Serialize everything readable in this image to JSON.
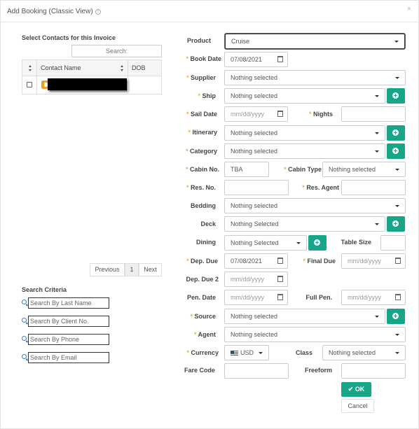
{
  "modal": {
    "title": "Add Booking (Classic View)",
    "close": "×",
    "help": "?"
  },
  "contacts": {
    "section_title": "Select Contacts for this Invoice",
    "search_placeholder": "Search:",
    "columns": [
      "Contact Name",
      "DOB"
    ],
    "pager": {
      "previous": "Previous",
      "page": "1",
      "next": "Next"
    }
  },
  "search_criteria": {
    "title": "Search Criteria",
    "fields": [
      "Search By Last Name",
      "Search By Client No.",
      "Search By Phone",
      "Search By Email"
    ]
  },
  "form": {
    "product": {
      "label": "Product",
      "value": "Cruise"
    },
    "book_date": {
      "label": "Book Date",
      "value": "07/08/2021"
    },
    "supplier": {
      "label": "Supplier",
      "value": "Nothing selected"
    },
    "ship": {
      "label": "Ship",
      "value": "Nothing selected"
    },
    "sail_date": {
      "label": "Sail Date",
      "placeholder": "mm/dd/yyyy"
    },
    "nights": {
      "label": "Nights",
      "value": ""
    },
    "itinerary": {
      "label": "Itinerary",
      "value": "Nothing selected"
    },
    "category": {
      "label": "Category",
      "value": "Nothing selected"
    },
    "cabin_no": {
      "label": "Cabin No.",
      "value": "TBA"
    },
    "cabin_type": {
      "label": "Cabin Type",
      "value": "Nothing selected"
    },
    "res_no": {
      "label": "Res. No.",
      "value": ""
    },
    "res_agent": {
      "label": "Res. Agent",
      "value": ""
    },
    "bedding": {
      "label": "Bedding",
      "value": "Nothing selected"
    },
    "deck": {
      "label": "Deck",
      "value": "Nothing Selected"
    },
    "dining": {
      "label": "Dining",
      "value": "Nothing Selected"
    },
    "table_size": {
      "label": "Table Size",
      "value": ""
    },
    "dep_due": {
      "label": "Dep. Due",
      "value": "07/08/2021"
    },
    "final_due": {
      "label": "Final Due",
      "placeholder": "mm/dd/yyyy"
    },
    "dep_due_2": {
      "label": "Dep. Due 2",
      "placeholder": "mm/dd/yyyy"
    },
    "pen_date": {
      "label": "Pen. Date",
      "placeholder": "mm/dd/yyyy"
    },
    "full_pen": {
      "label": "Full Pen.",
      "placeholder": "mm/dd/yyyy"
    },
    "source": {
      "label": "Source",
      "value": "Nothing selected"
    },
    "agent": {
      "label": "Agent",
      "value": "Nothing selected"
    },
    "currency": {
      "label": "Currency",
      "value": "USD"
    },
    "class": {
      "label": "Class",
      "value": "Nothing selected"
    },
    "fare_code": {
      "label": "Fare Code",
      "value": ""
    },
    "freeform": {
      "label": "Freeform",
      "value": ""
    }
  },
  "actions": {
    "ok": "OK",
    "cancel": "Cancel"
  },
  "colors": {
    "accent": "#18a689",
    "required": "#f0ad4e"
  }
}
